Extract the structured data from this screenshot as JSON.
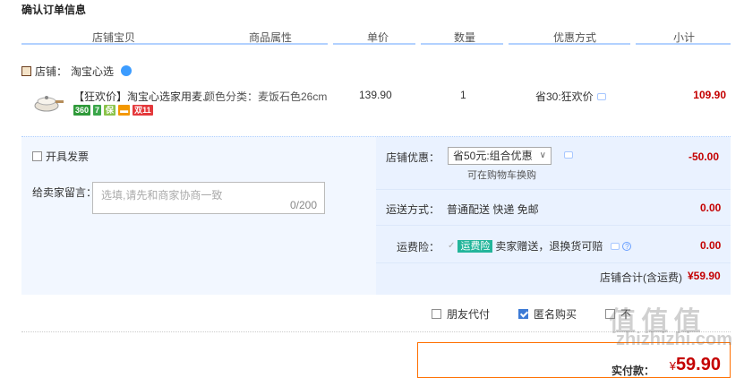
{
  "page_title": "确认订单信息",
  "columns": [
    "店铺宝贝",
    "商品属性",
    "单价",
    "数量",
    "优惠方式",
    "小计"
  ],
  "shop": {
    "label": "店铺：",
    "name": "淘宝心选"
  },
  "item": {
    "title": "【狂欢价】淘宝心选家用麦...",
    "attr": "颜色分类：麦饭石色26cm",
    "price": "139.90",
    "qty": "1",
    "promo": "省30:狂欢价",
    "subtotal": "109.90",
    "badges": [
      {
        "text": "360",
        "color": "#2f9a3a"
      },
      {
        "text": "7",
        "color": "#3aa64a"
      },
      {
        "text": "保",
        "color": "#8ac34a"
      },
      {
        "text": "▬",
        "color": "#f39800"
      },
      {
        "text": "双11",
        "color": "#e4393c"
      }
    ]
  },
  "invoice": {
    "label": "开具发票",
    "checked": false
  },
  "message": {
    "label": "给卖家留言：",
    "placeholder": "选填,请先和商家协商一致",
    "count": "0/200"
  },
  "shop_discount": {
    "label": "店铺优惠：",
    "selected": "省50元:组合优惠",
    "note": "可在购物车换购",
    "amount": "-50.00"
  },
  "shipping": {
    "label": "运送方式：",
    "value": "普通配送 快递 免邮",
    "amount": "0.00"
  },
  "insurance": {
    "label": "运费险：",
    "tag": "运费险",
    "value": "卖家赠送，退换货可赔",
    "amount": "0.00"
  },
  "shop_total": {
    "label": "店铺合计(含运费)",
    "value": "¥59.90"
  },
  "options": [
    {
      "label": "朋友代付",
      "checked": false
    },
    {
      "label": "匿名购买",
      "checked": true
    },
    {
      "label": "不",
      "checked": false
    }
  ],
  "pay": {
    "label": "实付款：",
    "currency": "¥",
    "value": "59.90"
  },
  "watermark": {
    "top": "值 值 值",
    "bottom": "zhizhizhi.com"
  }
}
